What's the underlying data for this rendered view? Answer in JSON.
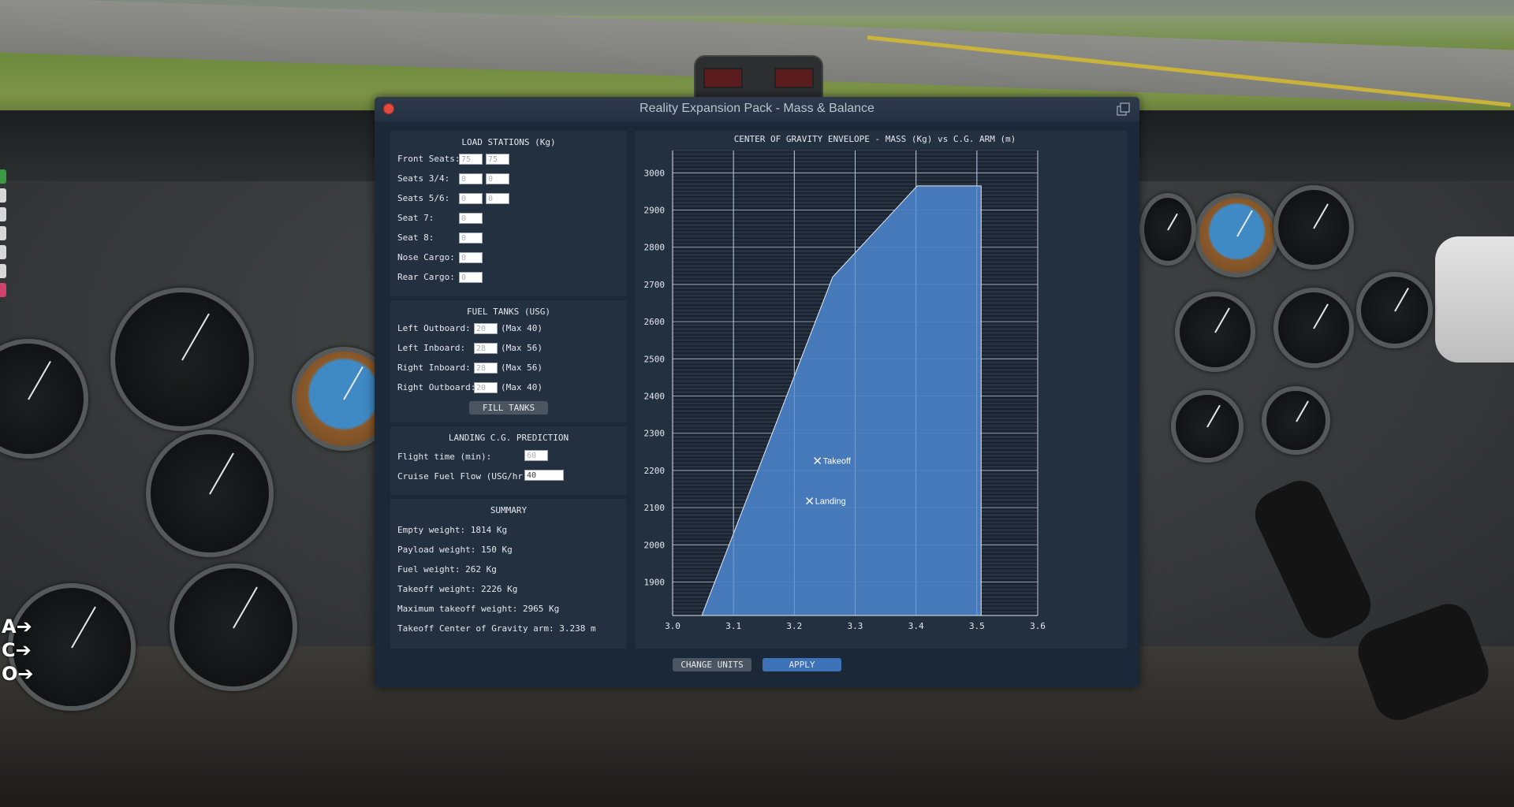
{
  "window": {
    "title": "Reality Expansion Pack - Mass & Balance"
  },
  "load_stations": {
    "title": "LOAD STATIONS (Kg)",
    "rows": [
      {
        "label": "Front Seats:",
        "values": [
          "75",
          "75"
        ]
      },
      {
        "label": "Seats 3/4:",
        "values": [
          "0",
          "0"
        ]
      },
      {
        "label": "Seats 5/6:",
        "values": [
          "0",
          "0"
        ]
      },
      {
        "label": "Seat 7:",
        "values": [
          "0"
        ]
      },
      {
        "label": "Seat 8:",
        "values": [
          "0"
        ]
      },
      {
        "label": "Nose Cargo:",
        "values": [
          "0"
        ]
      },
      {
        "label": "Rear Cargo:",
        "values": [
          "0"
        ]
      }
    ]
  },
  "fuel_tanks": {
    "title": "FUEL TANKS (USG)",
    "rows": [
      {
        "label": "Left Outboard:",
        "value": "20",
        "max": "(Max 40)"
      },
      {
        "label": "Left Inboard:",
        "value": "28",
        "max": "(Max 56)"
      },
      {
        "label": "Right Inboard:",
        "value": "28",
        "max": "(Max 56)"
      },
      {
        "label": "Right Outboard:",
        "value": "20",
        "max": "(Max 40)"
      }
    ],
    "fill_button": "FILL TANKS"
  },
  "landing_prediction": {
    "title": "LANDING C.G. PREDICTION",
    "flight_time_label": "Flight time (min):",
    "flight_time_value": "60",
    "cruise_flow_label": "Cruise Fuel Flow (USG/hr):",
    "cruise_flow_value": "40"
  },
  "summary": {
    "title": "SUMMARY",
    "lines": [
      "Empty weight: 1814 Kg",
      "Payload weight: 150 Kg",
      "Fuel weight: 262 Kg",
      "Takeoff weight: 2226 Kg",
      "Maximum takeoff weight: 2965 Kg",
      "Takeoff Center of Gravity arm: 3.238 m"
    ]
  },
  "buttons": {
    "change_units": "CHANGE UNITS",
    "apply": "APPLY"
  },
  "side_labels": [
    "A",
    "C",
    "O"
  ],
  "colors": {
    "window_bg": "#1b2838",
    "panel_bg": "#23303f",
    "envelope_fill": "#4a80c4",
    "apply_button": "#3d72b8",
    "close_button": "#e04a3f"
  },
  "chart_data": {
    "type": "area",
    "title": "CENTER OF GRAVITY ENVELOPE - MASS (Kg) vs C.G. ARM (m)",
    "xlabel": "C.G. ARM (m)",
    "ylabel": "MASS (Kg)",
    "xlim": [
      3.0,
      3.6
    ],
    "ylim": [
      1810,
      3060
    ],
    "x_ticks": [
      3.0,
      3.1,
      3.2,
      3.3,
      3.4,
      3.5,
      3.6
    ],
    "x_tick_labels": [
      "3.0",
      "3.1",
      "3.2",
      "3.3",
      "3.4",
      "3.5",
      "3.6"
    ],
    "y_ticks": [
      1900,
      2000,
      2100,
      2200,
      2300,
      2400,
      2500,
      2600,
      2700,
      2800,
      2900,
      3000
    ],
    "y_tick_labels": [
      "1900",
      "2000",
      "2100",
      "2200",
      "2300",
      "2400",
      "2500",
      "2600",
      "2700",
      "2800",
      "2900",
      "3000"
    ],
    "grid": true,
    "envelope": [
      {
        "x": 3.048,
        "y": 1810
      },
      {
        "x": 3.263,
        "y": 2720
      },
      {
        "x": 3.402,
        "y": 2965
      },
      {
        "x": 3.507,
        "y": 2965
      },
      {
        "x": 3.507,
        "y": 1810
      }
    ],
    "points": [
      {
        "name": "Takeoff",
        "x": 3.238,
        "y": 2226
      },
      {
        "name": "Landing",
        "x": 3.225,
        "y": 2118
      }
    ]
  }
}
